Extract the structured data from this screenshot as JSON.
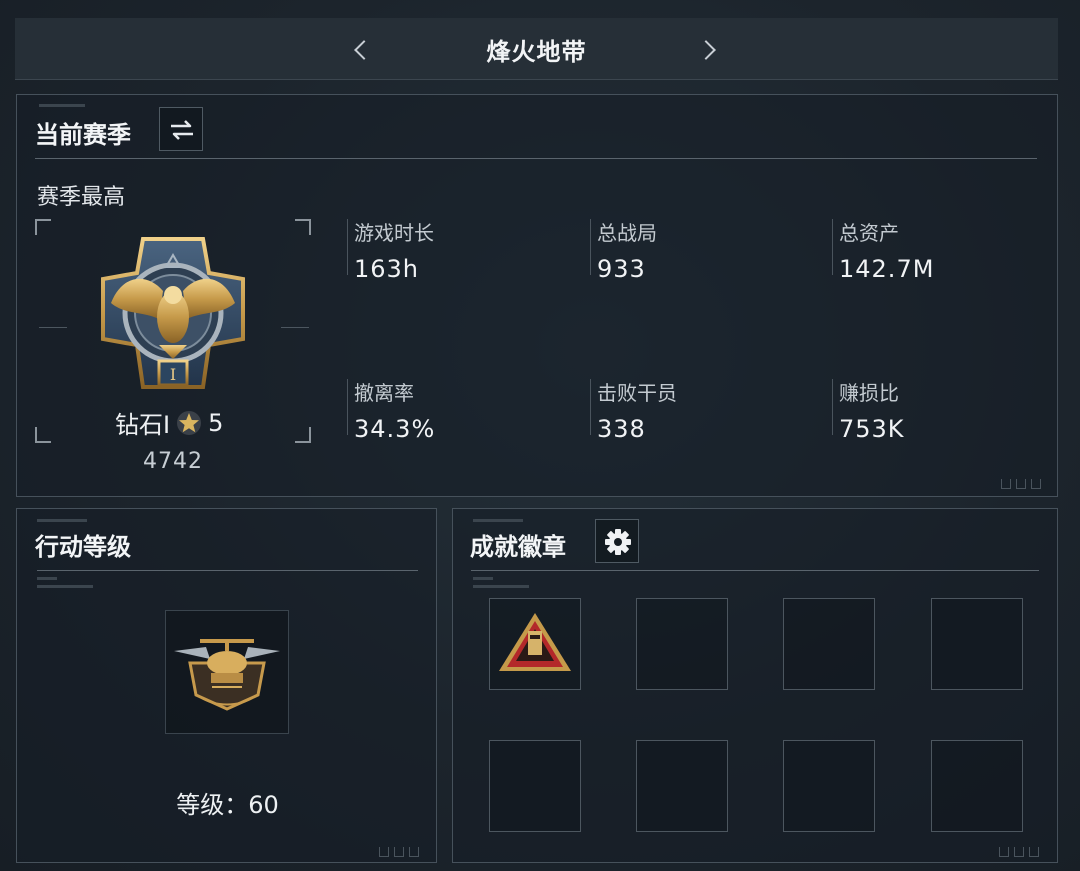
{
  "header": {
    "title": "烽火地带"
  },
  "season": {
    "title": "当前赛季",
    "subtitle": "赛季最高",
    "rank_name": "钻石I",
    "rank_stars": "5",
    "rank_points": "4742",
    "stats": [
      {
        "label": "游戏时长",
        "value": "163h"
      },
      {
        "label": "总战局",
        "value": "933"
      },
      {
        "label": "总资产",
        "value": "142.7M"
      },
      {
        "label": "撤离率",
        "value": "34.3%"
      },
      {
        "label": "击败干员",
        "value": "338"
      },
      {
        "label": "赚损比",
        "value": "753K"
      }
    ]
  },
  "action_level": {
    "title": "行动等级",
    "level_label": "等级：",
    "level_value": "60"
  },
  "achievements": {
    "title": "成就徽章"
  },
  "colors": {
    "background": "#1b232b",
    "border": "#46515b",
    "gold": "#c9a152",
    "badge_red": "#b0282a"
  }
}
